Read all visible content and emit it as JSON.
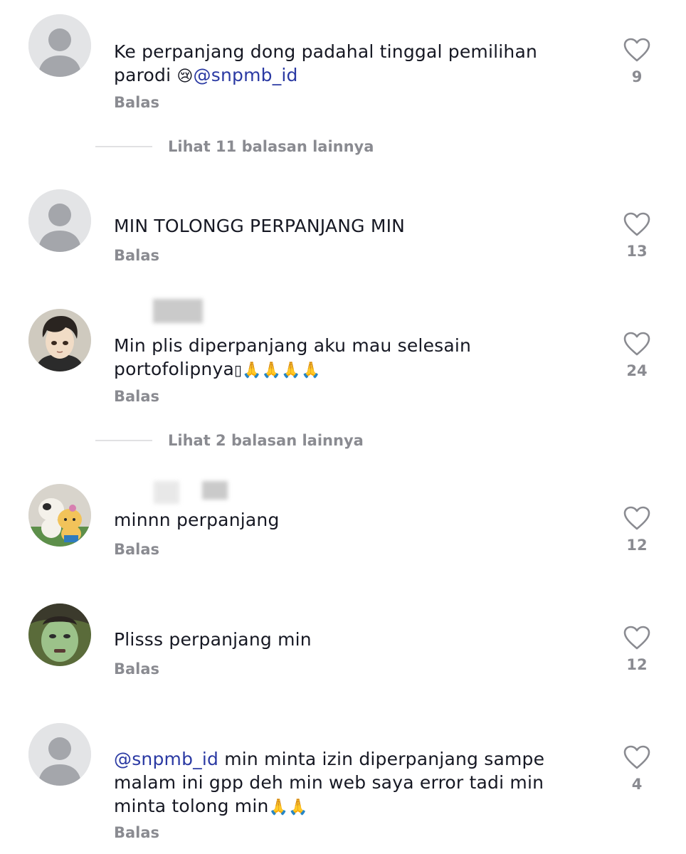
{
  "comments": [
    {
      "mention": "",
      "text_before": "Ke perpanjang dong padahal tinggal pemilihan\nparodi ",
      "emoji": "😢",
      "mention_after": "@snpmb_id",
      "reply_label": "Balas",
      "likes": "9",
      "avatar": "default"
    },
    {
      "text": "MIN TOLONGG PERPANJANG MIN",
      "reply_label": "Balas",
      "likes": "13",
      "avatar": "default"
    },
    {
      "text": "Min plis diperpanjang aku mau selesain\nportofolipnya",
      "emoji": "🙏🙏🙏🙏",
      "reply_label": "Balas",
      "likes": "24",
      "avatar": "anime-boy"
    },
    {
      "text": "minnn perpanjang",
      "reply_label": "Balas",
      "likes": "12",
      "avatar": "plush-toys"
    },
    {
      "text": "Plisss perpanjang min",
      "reply_label": "Balas",
      "likes": "12",
      "avatar": "green-mask-face"
    },
    {
      "mention": "@snpmb_id",
      "text": " min minta izin diperpanjang sampe\nmalam ini gpp deh min web saya error tadi min\nminta tolong min",
      "emoji": "🙏🙏",
      "reply_label": "Balas",
      "likes": "4",
      "avatar": "default"
    }
  ],
  "view_more": [
    {
      "label": "Lihat 11 balasan lainnya"
    },
    {
      "label": "Lihat 2 balasan lainnya"
    }
  ],
  "colors": {
    "text": "#161823",
    "muted": "#8a8b91",
    "mention": "#2b3aa3",
    "avatar_bg": "#e3e4e6",
    "avatar_fg": "#a4a6ab"
  }
}
